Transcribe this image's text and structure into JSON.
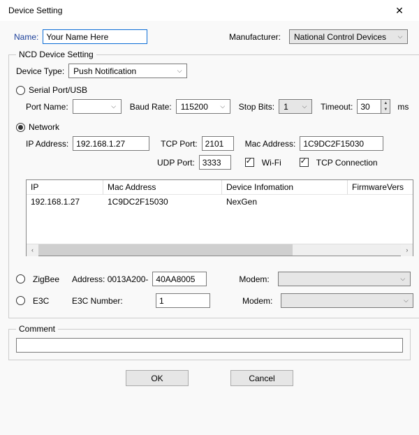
{
  "window": {
    "title": "Device Setting",
    "close_icon": "✕"
  },
  "top": {
    "name_label": "Name:",
    "name_value": "Your Name Here",
    "manufacturer_label": "Manufacturer:",
    "manufacturer_value": "National Control Devices"
  },
  "ncd": {
    "legend": "NCD Device Setting",
    "device_type_label": "Device Type:",
    "device_type_value": "Push Notification",
    "serial_label": "Serial Port/USB",
    "serial_checked": false,
    "serial": {
      "port_name_label": "Port Name:",
      "port_name_value": "",
      "baud_label": "Baud Rate:",
      "baud_value": "115200",
      "stop_label": "Stop Bits:",
      "stop_value": "1",
      "timeout_label": "Timeout:",
      "timeout_value": "30",
      "timeout_unit": "ms"
    },
    "network_label": "Network",
    "network_checked": true,
    "network": {
      "ip_label": "IP Address:",
      "ip_value": "192.168.1.27",
      "tcp_label": "TCP Port:",
      "tcp_value": "2101",
      "mac_label": "Mac Address:",
      "mac_value": "1C9DC2F15030",
      "udp_label": "UDP Port:",
      "udp_value": "3333",
      "wifi_label": "Wi-Fi",
      "wifi_checked": true,
      "tcpconn_label": "TCP Connection",
      "tcpconn_checked": true
    },
    "table": {
      "headers": {
        "ip": "IP",
        "mac": "Mac Address",
        "info": "Device Infomation",
        "fw": "FirmwareVers"
      },
      "rows": [
        {
          "ip": "192.168.1.27",
          "mac": "1C9DC2F15030",
          "info": "NexGen",
          "fw": ""
        }
      ]
    },
    "zigbee": {
      "label": "ZigBee",
      "checked": false,
      "address_label": "Address: 0013A200-",
      "address_value": "40AA8005",
      "modem_label": "Modem:",
      "modem_value": ""
    },
    "e3c": {
      "label": "E3C",
      "checked": false,
      "number_label": "E3C Number:",
      "number_value": "1",
      "modem_label": "Modem:",
      "modem_value": ""
    }
  },
  "comment": {
    "legend": "Comment",
    "value": ""
  },
  "buttons": {
    "ok": "OK",
    "cancel": "Cancel"
  },
  "icons": {
    "caret": "⌵",
    "left_arrow": "‹",
    "right_arrow": "›",
    "up": "▲",
    "down": "▼"
  }
}
